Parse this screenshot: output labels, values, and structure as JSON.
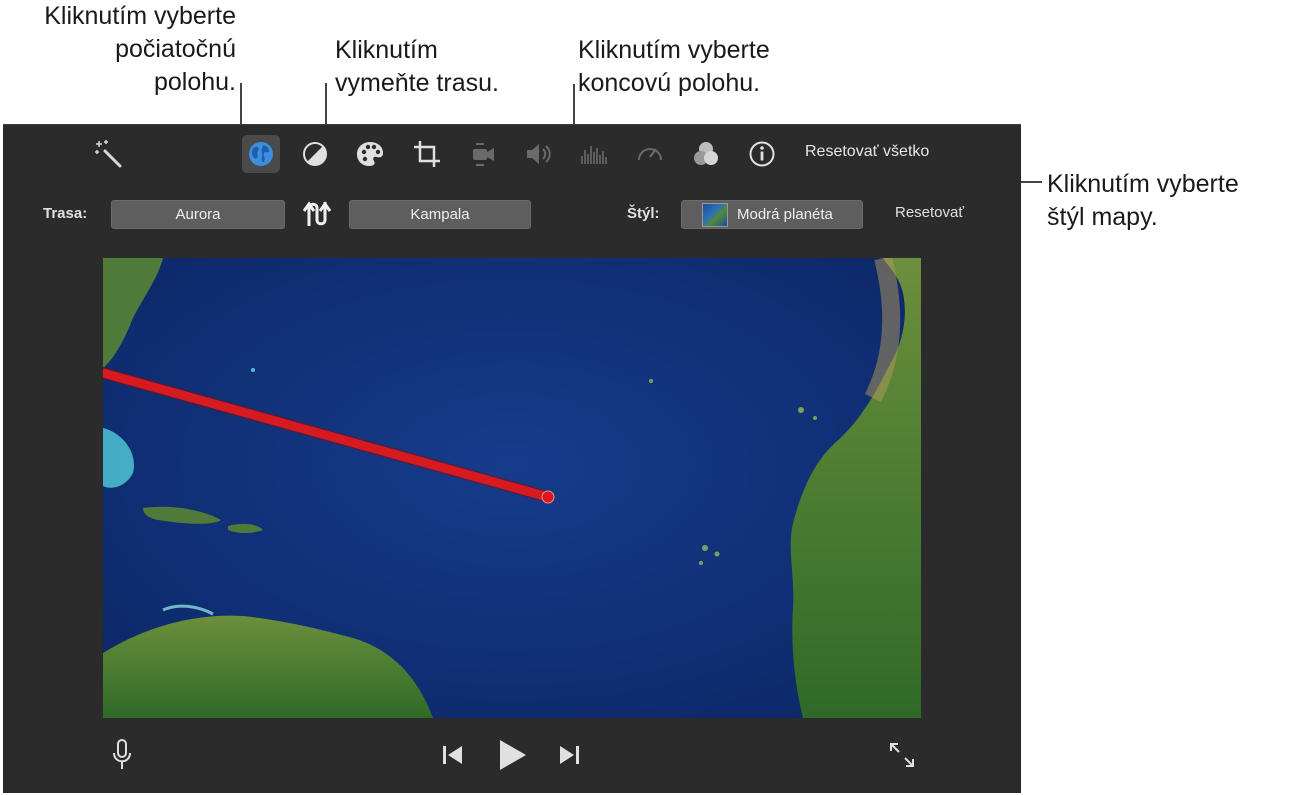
{
  "callouts": {
    "start": [
      "Kliknutím vyberte",
      "počiatočnú",
      "polohu."
    ],
    "swap": [
      "Kliknutím",
      "vymeňte trasu."
    ],
    "end": [
      "Kliknutím vyberte",
      "koncovú polohu."
    ],
    "style": [
      "Kliknutím vyberte",
      "štýl mapy."
    ]
  },
  "toolbar": {
    "icons": [
      "magic-wand-icon",
      "globe-icon",
      "color-balance-icon",
      "palette-icon",
      "crop-icon",
      "stabilization-icon",
      "volume-icon",
      "equalizer-icon",
      "speed-icon",
      "clip-filter-icon",
      "info-icon"
    ],
    "reset_all": "Resetovať všetko"
  },
  "route": {
    "label": "Trasa:",
    "start": "Aurora",
    "end": "Kampala"
  },
  "style": {
    "label": "Štýl:",
    "value": "Modrá planéta",
    "reset": "Resetovať"
  },
  "colors": {
    "route_line": "#d71920",
    "panel_bg": "#2b2b2b",
    "button_bg": "#5e5e5e",
    "active_icon": "#3d8ee0",
    "ocean": "#14367f",
    "land": "#3f7a32"
  },
  "playback": {
    "icons": [
      "microphone-icon",
      "skip-back-icon",
      "play-icon",
      "skip-forward-icon",
      "fullscreen-icon"
    ]
  }
}
